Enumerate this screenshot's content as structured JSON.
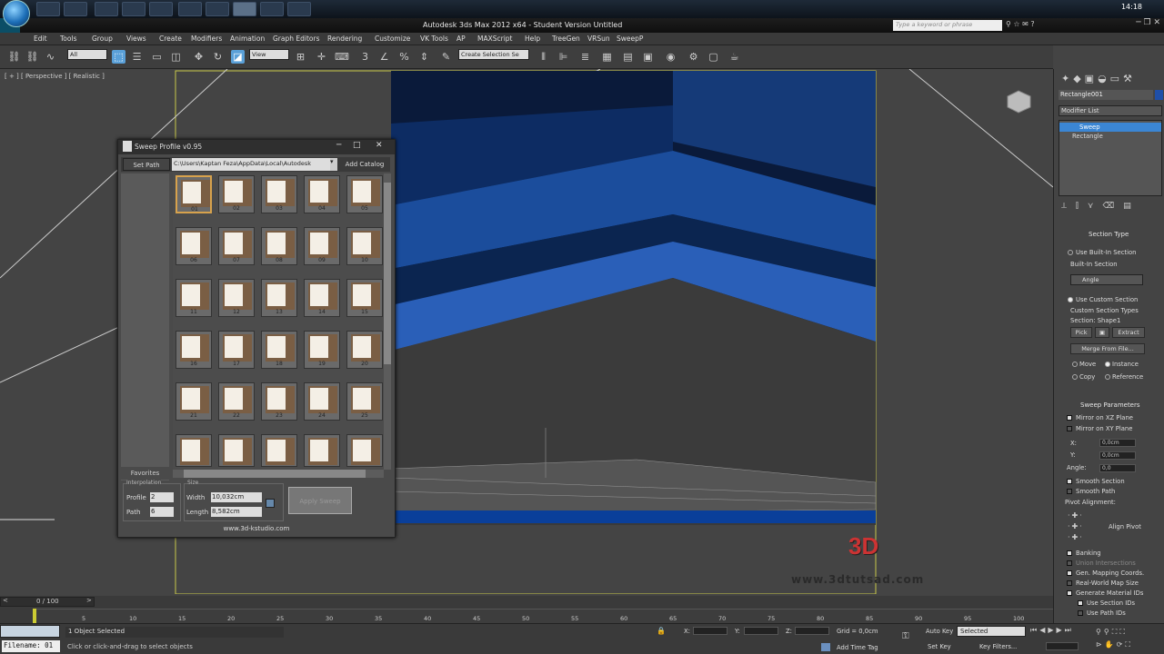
{
  "taskbar": {
    "time": "14:18"
  },
  "window": {
    "title": "Autodesk 3ds Max  2012 x64  -  Student Version   Untitled",
    "search_placeholder": "Type a keyword or phrase"
  },
  "menu": [
    "Edit",
    "Tools",
    "Group",
    "Views",
    "Create",
    "Modifiers",
    "Animation",
    "Graph Editors",
    "Rendering",
    "Customize",
    "VK Tools",
    "AP",
    "MAXScript",
    "Help",
    "TreeGen",
    "VRSun",
    "SweepP"
  ],
  "toolbar": {
    "selection_filter": "All",
    "ref_coord": "View",
    "named_selection": "Create Selection Se"
  },
  "viewport": {
    "label": "[ + ] [ Perspective ] [ Realistic ]"
  },
  "dialog": {
    "title": "Sweep Profile v0.95",
    "set_path": "Set Path",
    "path_value": "C:\\Users\\Kaptan Feza\\AppData\\Local\\Autodesk",
    "add_catalog": "Add Catalog",
    "favorites": "Favorites",
    "thumbs": [
      "01",
      "02",
      "03",
      "04",
      "05",
      "06",
      "07",
      "08",
      "09",
      "10",
      "11",
      "12",
      "13",
      "14",
      "15",
      "16",
      "17",
      "18",
      "19",
      "20",
      "21",
      "22",
      "23",
      "24",
      "25"
    ],
    "interpolation_label": "Interpolation",
    "profile_label": "Profile",
    "profile_value": "2",
    "path_label": "Path",
    "path_steps": "6",
    "size_label": "Size",
    "width_label": "Width",
    "width_value": "10,032cm",
    "length_label": "Length",
    "length_value": "8,582cm",
    "apply_label": "Apply Sweep",
    "website": "www.3d-kstudio.com"
  },
  "panel": {
    "object_name": "Rectangle001",
    "modifier_list": "Modifier List",
    "stack": [
      "Sweep",
      "Rectangle"
    ],
    "section_type": "Section Type",
    "use_builtin": "Use Built-In Section",
    "builtin_section": "Built-In Section",
    "angle": "Angle",
    "use_custom": "Use Custom Section",
    "custom_types": "Custom Section Types",
    "section_shape": "Section: Shape1",
    "pick": "Pick",
    "extract": "Extract",
    "merge": "Merge From File...",
    "move": "Move",
    "instance": "Instance",
    "copy": "Copy",
    "reference": "Reference",
    "sweep_params": "Sweep Parameters",
    "mirror_xz": "Mirror on XZ Plane",
    "mirror_xy": "Mirror on XY Plane",
    "x_label": "X:",
    "x_value": "0,0cm",
    "y_label": "Y:",
    "y_value": "0,0cm",
    "angle_label": "Angle:",
    "angle_value": "0,0",
    "smooth_section": "Smooth Section",
    "smooth_path": "Smooth Path",
    "pivot_alignment": "Pivot Alignment:",
    "align_pivot": "Align Pivot",
    "banking": "Banking",
    "union_intersections": "Union Intersections",
    "gen_mapping": "Gen. Mapping Coords.",
    "real_world": "Real-World Map Size",
    "gen_material": "Generate Material IDs",
    "use_section_ids": "Use Section IDs",
    "use_path_ids": "Use Path IDs"
  },
  "timeline": {
    "frame": "0 / 100",
    "ticks": [
      "0",
      "5",
      "10",
      "15",
      "20",
      "25",
      "30",
      "35",
      "40",
      "45",
      "50",
      "55",
      "60",
      "65",
      "70",
      "75",
      "80",
      "85",
      "90",
      "95",
      "100"
    ]
  },
  "status": {
    "filename_label": "Filename: 01",
    "selected": "1 Object Selected",
    "prompt": "Click or click-and-drag to select objects",
    "x": "X:",
    "y": "Y:",
    "z": "Z:",
    "grid": "Grid = 0,0cm",
    "add_time_tag": "Add Time Tag",
    "auto_key": "Auto Key",
    "selected_dd": "Selected",
    "set_key": "Set Key",
    "key_filters": "Key Filters..."
  },
  "watermark": "3D",
  "watermark_url": "www.3dtutsad.com"
}
